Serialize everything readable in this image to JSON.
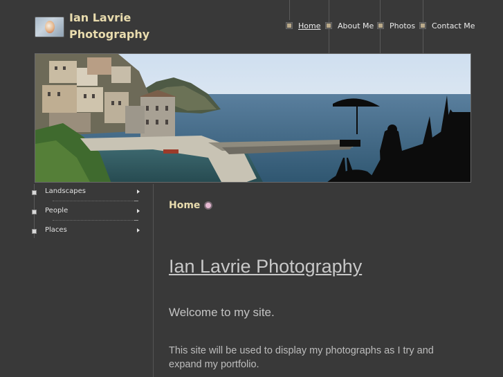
{
  "header": {
    "site_title": "Ian Lavrie Photography"
  },
  "nav": {
    "items": [
      {
        "label": "Home",
        "active": true
      },
      {
        "label": "About Me",
        "active": false
      },
      {
        "label": "Photos",
        "active": false
      },
      {
        "label": "Contact Me",
        "active": false
      }
    ]
  },
  "sidebar": {
    "items": [
      {
        "label": "Landscapes",
        "icon": "chevron-right-icon"
      },
      {
        "label": "People",
        "icon": "chevron-right-icon"
      },
      {
        "label": "Places",
        "icon": "chevron-right-icon"
      }
    ]
  },
  "main": {
    "breadcrumb": "Home",
    "heading": "Ian Lavrie Photography",
    "welcome": "Welcome to my site.",
    "intro": "This site will be used to display my photographs as I try and expand my portfolio."
  },
  "colors": {
    "background": "#393939",
    "title_accent": "#e9dcae",
    "link_grey": "#c8c8c8"
  }
}
